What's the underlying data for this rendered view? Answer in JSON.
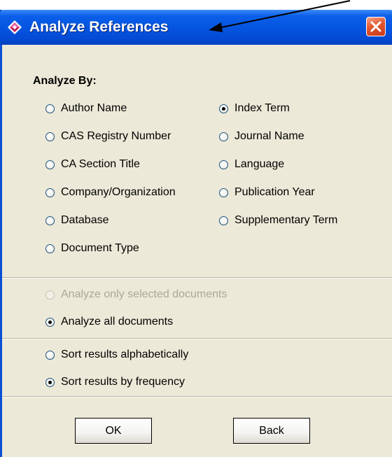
{
  "window": {
    "title": "Analyze References",
    "colors": {
      "titlebar": "#0554e0",
      "close_button": "#e3582f",
      "body": "#ece9d8"
    }
  },
  "analyze_by": {
    "label": "Analyze By:",
    "options": [
      {
        "label": "Author Name",
        "checked": false
      },
      {
        "label": "CAS Registry Number",
        "checked": false
      },
      {
        "label": "CA Section Title",
        "checked": false
      },
      {
        "label": "Company/Organization",
        "checked": false
      },
      {
        "label": "Database",
        "checked": false
      },
      {
        "label": "Document Type",
        "checked": false
      },
      {
        "label": "Index Term",
        "checked": true
      },
      {
        "label": "Journal Name",
        "checked": false
      },
      {
        "label": "Language",
        "checked": false
      },
      {
        "label": "Publication Year",
        "checked": false
      },
      {
        "label": "Supplementary Term",
        "checked": false
      }
    ]
  },
  "scope": {
    "options": [
      {
        "label": "Analyze only selected documents",
        "checked": false,
        "disabled": true
      },
      {
        "label": "Analyze all documents",
        "checked": true,
        "disabled": false
      }
    ]
  },
  "sort": {
    "options": [
      {
        "label": "Sort results alphabetically",
        "checked": false
      },
      {
        "label": "Sort results by frequency",
        "checked": true
      }
    ]
  },
  "buttons": {
    "ok": "OK",
    "back": "Back"
  }
}
